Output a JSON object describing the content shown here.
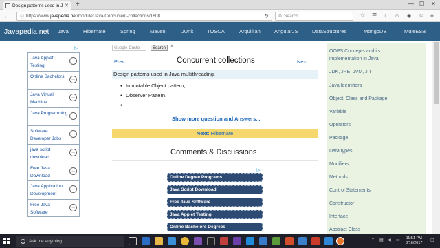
{
  "browser": {
    "tab_title": "Design patterns used in Ja...",
    "url_prefix": "https://www.",
    "url_host": "javapedia.net",
    "url_path": "/module/Java/Concurrent-collections/1608",
    "search_placeholder": "Search"
  },
  "site": {
    "logo": "Javapedia.net",
    "nav": [
      "Java",
      "Hibernate",
      "Spring",
      "Maven",
      "JUnit",
      "TOSCA",
      "Arquillian",
      "AngularJS",
      "DataStructures",
      "MongoDB",
      "MuleESB"
    ]
  },
  "left_ads": [
    "Java Applet Testing",
    "Online Bachelors",
    "Java Virtual Machine",
    "Java Programming",
    "Software Developer Jobs",
    "java script download",
    "Free Java Download",
    "Java Application Development",
    "Free Java Software"
  ],
  "search": {
    "tag": "Google",
    "placeholder": "Custo",
    "button": "Search",
    "clear": "×"
  },
  "main": {
    "prev": "Prev",
    "next": "Next",
    "title": "Concurrent collections",
    "question": "Design patterns used in Java multithreading.",
    "bullets": [
      "Immutable Object pattern,",
      "Observer Pattern.",
      ""
    ],
    "show_more": "Show more question and Answers...",
    "next_label": "Next:",
    "next_link": "Hibernate",
    "comments": "Comments & Discussions"
  },
  "center_ads": [
    "Online Degree Programs",
    "Java Script Download",
    "Free Java Software",
    "Java Applet Testing",
    "Online Bachelors Degrees"
  ],
  "right_nav": [
    "OOPS Concepts and its",
    "implementation in Java",
    "JDK, JRE, JVM, JIT",
    "Java Identifiers",
    "Object, Class and Package",
    "Variable",
    "Operators",
    "Package",
    "Data types",
    "Modifiers",
    "Methods",
    "Control Statements",
    "Constructor",
    "Interface",
    "Abstract Class"
  ],
  "taskbar": {
    "cortana": "Ask me anything",
    "time": "11:51 PM",
    "date": "3/16/2017"
  },
  "colors": {
    "header": "#2e5f87",
    "link": "#1a66b8",
    "next_bar": "#f5d76e",
    "sidebar": "#eaf3e1"
  }
}
